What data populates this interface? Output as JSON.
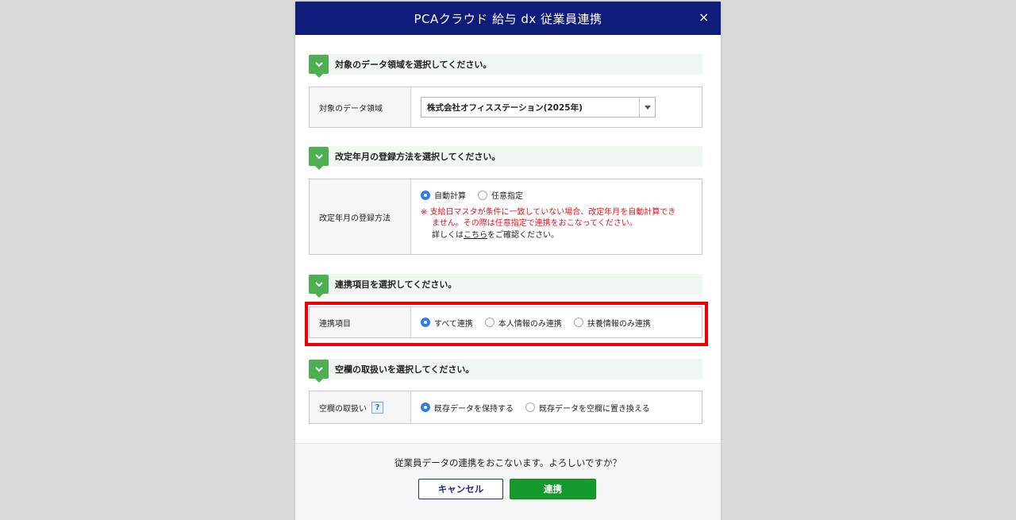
{
  "dialog": {
    "title": "PCAクラウド 給与 dx 従業員連携",
    "close": "×"
  },
  "sections": {
    "data_area": {
      "heading": "対象のデータ領域を選択してください。",
      "label": "対象のデータ領域",
      "selected": "株式会社オフィスステーション(2025年)"
    },
    "revision": {
      "heading": "改定年月の登録方法を選択してください。",
      "label": "改定年月の登録方法",
      "options": [
        "自動計算",
        "任意指定"
      ],
      "selected_index": 0,
      "warning_line1": "※ 支給日マスタが条件に一致していない場合、改定年月を自動計算でき",
      "warning_line2": "ません。その際は任意指定で連携をおこなってください。",
      "note_prefix": "詳しくは",
      "note_link": "こちら",
      "note_suffix": "をご確認ください。"
    },
    "items": {
      "heading": "連携項目を選択してください。",
      "label": "連携項目",
      "options": [
        "すべて連携",
        "本人情報のみ連携",
        "扶養情報のみ連携"
      ],
      "selected_index": 0
    },
    "blank": {
      "heading": "空欄の取扱いを選択してください。",
      "label": "空欄の取扱い",
      "help": "?",
      "options": [
        "既存データを保持する",
        "既存データを空欄に置き換える"
      ],
      "selected_index": 0
    }
  },
  "footer": {
    "confirm": "従業員データの連携をおこないます。よろしいですか？",
    "cancel": "キャンセル",
    "ok": "連携"
  },
  "colors": {
    "titlebar": "#0f1c7a",
    "accent_green": "#4caf50",
    "ok_button": "#159a2d",
    "warning": "#e8131b",
    "highlight": "#ee0000"
  }
}
